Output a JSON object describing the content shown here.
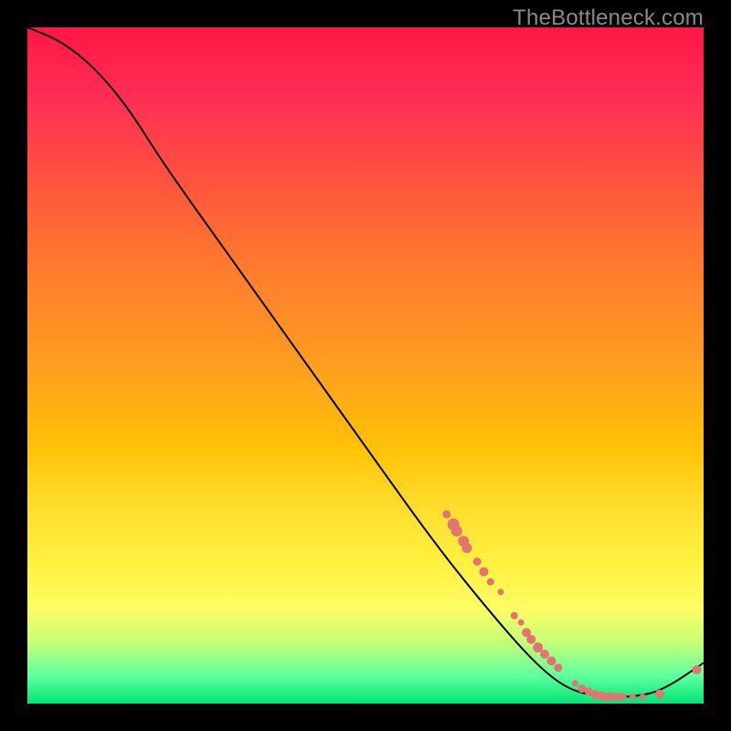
{
  "watermark": "TheBottleneck.com",
  "chart_data": {
    "type": "line",
    "title": "",
    "xlabel": "",
    "ylabel": "",
    "xlim": [
      0,
      100
    ],
    "ylim": [
      0,
      100
    ],
    "grid": false,
    "curve": [
      {
        "x": 0,
        "y": 100
      },
      {
        "x": 5,
        "y": 98
      },
      {
        "x": 10,
        "y": 94
      },
      {
        "x": 15,
        "y": 88
      },
      {
        "x": 20,
        "y": 80
      },
      {
        "x": 30,
        "y": 66
      },
      {
        "x": 40,
        "y": 52
      },
      {
        "x": 50,
        "y": 38
      },
      {
        "x": 60,
        "y": 24
      },
      {
        "x": 68,
        "y": 14
      },
      {
        "x": 75,
        "y": 6
      },
      {
        "x": 80,
        "y": 2
      },
      {
        "x": 85,
        "y": 1
      },
      {
        "x": 90,
        "y": 1
      },
      {
        "x": 94,
        "y": 2
      },
      {
        "x": 100,
        "y": 6
      }
    ],
    "series": [
      {
        "name": "cluster-upper",
        "color": "#e57373",
        "points": [
          {
            "x": 62,
            "y": 28,
            "r": 4.5
          },
          {
            "x": 63,
            "y": 26.5,
            "r": 6.5
          },
          {
            "x": 63.5,
            "y": 25.5,
            "r": 6
          },
          {
            "x": 64.5,
            "y": 24,
            "r": 6
          },
          {
            "x": 65,
            "y": 23,
            "r": 5.5
          },
          {
            "x": 66.5,
            "y": 21,
            "r": 4.5
          },
          {
            "x": 67.5,
            "y": 19.5,
            "r": 5
          },
          {
            "x": 68.5,
            "y": 18,
            "r": 4
          },
          {
            "x": 70,
            "y": 16.5,
            "r": 3.5
          }
        ]
      },
      {
        "name": "cluster-mid",
        "color": "#e57373",
        "points": [
          {
            "x": 72,
            "y": 13,
            "r": 4
          },
          {
            "x": 73,
            "y": 12,
            "r": 3.5
          },
          {
            "x": 73.8,
            "y": 10.5,
            "r": 5
          },
          {
            "x": 74.5,
            "y": 9.5,
            "r": 5
          },
          {
            "x": 75.5,
            "y": 8.3,
            "r": 5.5
          },
          {
            "x": 76.5,
            "y": 7.3,
            "r": 5
          },
          {
            "x": 77.5,
            "y": 6.3,
            "r": 5
          },
          {
            "x": 78.5,
            "y": 5.3,
            "r": 4.5
          }
        ]
      },
      {
        "name": "cluster-valley",
        "color": "#e57373",
        "points": [
          {
            "x": 81,
            "y": 3,
            "r": 3.5
          },
          {
            "x": 82,
            "y": 2.2,
            "r": 4.5
          },
          {
            "x": 83,
            "y": 1.8,
            "r": 4.5
          },
          {
            "x": 84,
            "y": 1.3,
            "r": 5
          },
          {
            "x": 85,
            "y": 1.1,
            "r": 5
          },
          {
            "x": 86,
            "y": 1,
            "r": 5
          },
          {
            "x": 87,
            "y": 1,
            "r": 4.5
          },
          {
            "x": 88,
            "y": 1,
            "r": 4.5
          },
          {
            "x": 89.5,
            "y": 1,
            "r": 3.5
          },
          {
            "x": 91,
            "y": 1,
            "r": 3.5
          },
          {
            "x": 93.5,
            "y": 1.4,
            "r": 5
          },
          {
            "x": 99,
            "y": 5,
            "r": 5
          }
        ]
      }
    ]
  },
  "colors": {
    "curve": "#000000",
    "point": "#e57373"
  }
}
